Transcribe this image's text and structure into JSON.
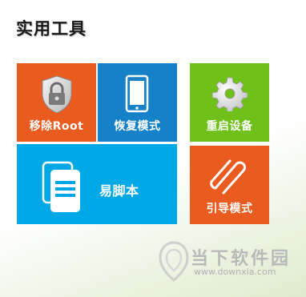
{
  "header": {
    "title": "实用工具"
  },
  "tiles": {
    "remove_root": {
      "label": "移除Root",
      "icon": "shield-lock-icon",
      "color": "#ea5b1f"
    },
    "recovery": {
      "label": "恢复模式",
      "icon": "phone-icon",
      "color": "#1581c8"
    },
    "reboot": {
      "label": "重启设备",
      "icon": "gear-icon",
      "color": "#6fc11a"
    },
    "script": {
      "label": "易脚本",
      "icon": "documents-icon",
      "color": "#00a9e5"
    },
    "guide": {
      "label": "引导模式",
      "icon": "paperclip-icon",
      "color": "#ea5b1f"
    }
  },
  "watermark": {
    "title": "当下软件园",
    "url": "www.downxia.com",
    "icon": "downxia-logo"
  }
}
